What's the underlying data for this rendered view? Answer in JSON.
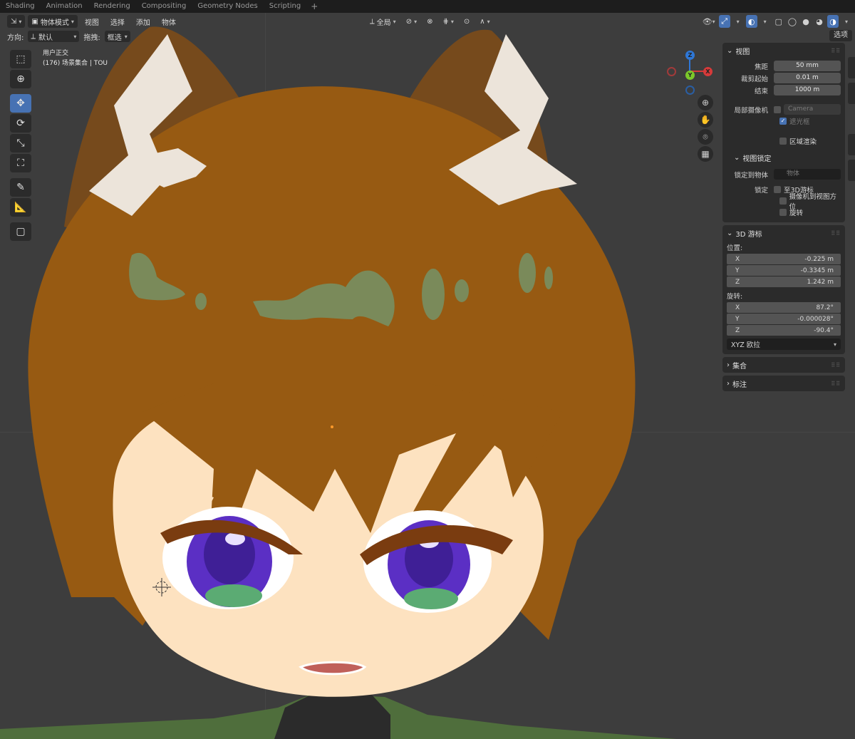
{
  "workspace_tabs": [
    "Shading",
    "Animation",
    "Rendering",
    "Compositing",
    "Geometry Nodes",
    "Scripting"
  ],
  "header": {
    "mode": "物体模式",
    "menus": [
      "视图",
      "选择",
      "添加",
      "物体"
    ],
    "transform_orientation": "全局"
  },
  "subheader": {
    "orientation_label": "方向:",
    "orientation_value": "默认",
    "drag_label": "拖拽:",
    "drag_value": "框选",
    "options_label": "选项"
  },
  "view_info": {
    "line1": "用户正交",
    "line2": "(176) 场景集合 | TOU"
  },
  "gizmo": {
    "x": "X",
    "y": "Y",
    "z": "Z"
  },
  "sidebar": {
    "view_panel": {
      "title": "视图",
      "focal_label": "焦距",
      "focal_value": "50 mm",
      "clip_start_label": "裁剪起始",
      "clip_start_value": "0.01 m",
      "clip_end_label": "结束",
      "clip_end_value": "1000 m",
      "local_camera_label": "局部摄像机",
      "camera_value": "Camera",
      "passepartout_label": "遮光框",
      "region_render_label": "区域渲染"
    },
    "view_lock_panel": {
      "title": "视图锁定",
      "lock_to_object_label": "锁定到物体",
      "lock_to_object_placeholder": "物体",
      "lock_label": "锁定",
      "to_cursor_label": "至3D游标",
      "camera_to_view_label": "摄像机到视图方位",
      "rotation_label": "旋转"
    },
    "cursor_panel": {
      "title": "3D 游标",
      "location_label": "位置:",
      "location": [
        {
          "axis": "X",
          "value": "-0.225 m"
        },
        {
          "axis": "Y",
          "value": "-0.3345 m"
        },
        {
          "axis": "Z",
          "value": "1.242 m"
        }
      ],
      "rotation_label": "旋转:",
      "rotation": [
        {
          "axis": "X",
          "value": "87.2°"
        },
        {
          "axis": "Y",
          "value": "-0.000028°"
        },
        {
          "axis": "Z",
          "value": "-90.4°"
        }
      ],
      "rotation_mode": "XYZ 欧拉"
    },
    "collection_panel": {
      "title": "集合"
    },
    "annotation_panel": {
      "title": "标注"
    }
  },
  "colors": {
    "accent": "#4772b3",
    "hair": "#9a5a10",
    "skin": "#fde2c0",
    "iris": "#5b2fc4",
    "clothing": "#4f6e3c"
  }
}
